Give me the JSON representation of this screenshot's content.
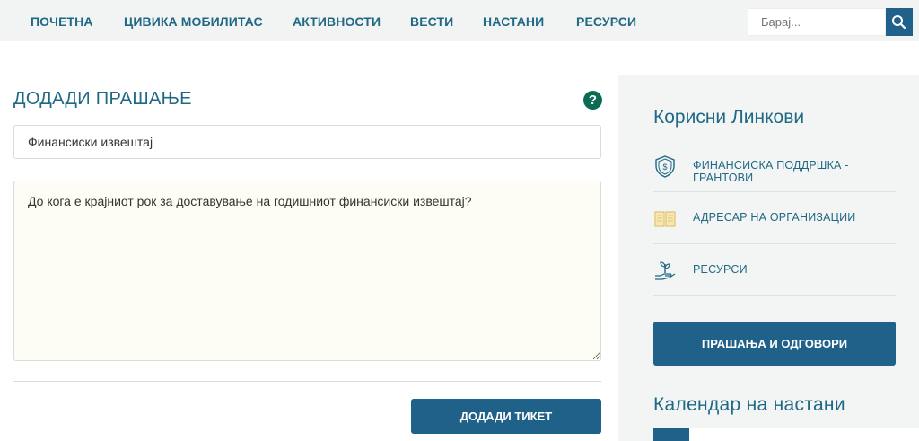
{
  "nav": {
    "items": [
      "ПОЧЕТНА",
      "ЦИВИКА МОБИЛИТАС",
      "АКТИВНОСТИ",
      "ВЕСТИ",
      "НАСТАНИ",
      "РЕСУРСИ"
    ],
    "search_placeholder": "Барај..."
  },
  "form": {
    "title": "ДОДАДИ ПРАШАЊЕ",
    "help_glyph": "?",
    "subject_value": "Финансиски извештај",
    "message_value": "До кога е крајниот рок за доставување на годишниот финансиски извештај?",
    "submit_label": "ДОДАДИ ТИКЕТ"
  },
  "sidebar": {
    "title": "Корисни Линкови",
    "links": [
      {
        "label": "ФИНАНСИСКА ПОДДРШКА - ГРАНТОВИ",
        "icon": "shield-dollar-icon"
      },
      {
        "label": "АДРЕСАР НА ОРГАНИЗАЦИИ",
        "icon": "open-book-icon"
      },
      {
        "label": "РЕСУРСИ",
        "icon": "hand-plant-icon"
      }
    ],
    "qa_button": "ПРАШАЊА И ОДГОВОРИ",
    "calendar_title": "Календар на настани"
  },
  "colors": {
    "brand": "#1f6189",
    "text_accent": "#1f6986",
    "help_green": "#0c6b55",
    "icon_gold": "#e2c470"
  }
}
